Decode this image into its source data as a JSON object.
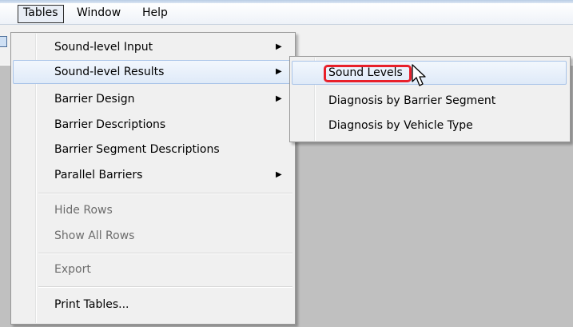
{
  "menubar": {
    "items": [
      {
        "label": "Tables",
        "active": true
      },
      {
        "label": "Window",
        "active": false
      },
      {
        "label": "Help",
        "active": false
      }
    ]
  },
  "tables_menu": {
    "items": [
      {
        "label": "Sound-level Input",
        "submenu": true,
        "enabled": true
      },
      {
        "label": "Sound-level Results",
        "submenu": true,
        "enabled": true,
        "highlighted": true
      },
      {
        "label": "Barrier Design",
        "submenu": true,
        "enabled": true
      },
      {
        "label": "Barrier Descriptions",
        "submenu": false,
        "enabled": true
      },
      {
        "label": "Barrier Segment Descriptions",
        "submenu": false,
        "enabled": true
      },
      {
        "label": "Parallel Barriers",
        "submenu": true,
        "enabled": true
      },
      {
        "label": "Hide Rows",
        "submenu": false,
        "enabled": false
      },
      {
        "label": "Show All Rows",
        "submenu": false,
        "enabled": false
      },
      {
        "label": "Export",
        "submenu": false,
        "enabled": false
      },
      {
        "label": "Print Tables...",
        "submenu": false,
        "enabled": true
      }
    ],
    "arrow_glyph": "▶"
  },
  "results_submenu": {
    "items": [
      {
        "label": "Sound Levels",
        "highlighted": true
      },
      {
        "label": "Diagnosis by Barrier Segment"
      },
      {
        "label": "Diagnosis by Vehicle Type"
      }
    ]
  },
  "colors": {
    "highlight_outline": "#e8202a",
    "menu_background": "#f0f0f0",
    "workspace": "#c0c0c0"
  },
  "icons": [
    "submenu-arrow-icon",
    "mouse-pointer-icon",
    "toolbar-icon"
  ]
}
